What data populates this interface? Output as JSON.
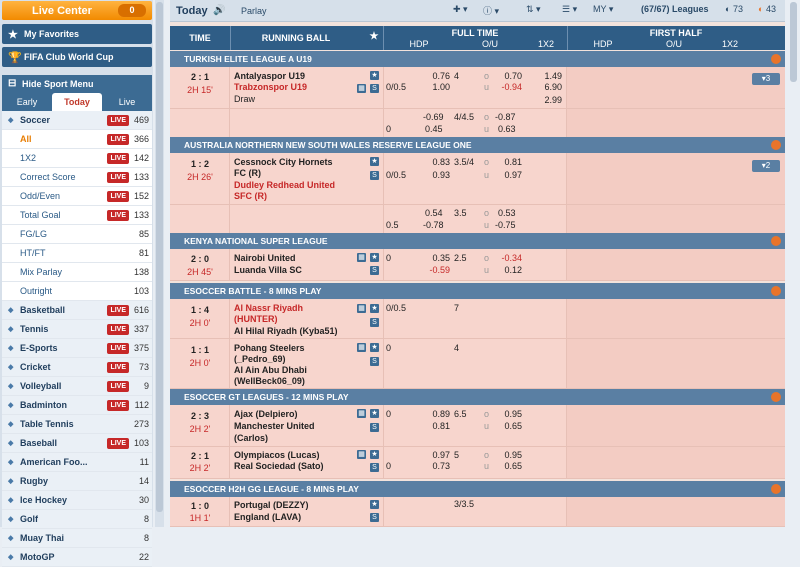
{
  "sidebar": {
    "live_center": "Live Center",
    "live_count": "0",
    "favorites": "My Favorites",
    "club_cup": "FIFA Club World Cup",
    "hide_menu": "Hide Sport Menu",
    "tabs": [
      "Early",
      "Today",
      "Live"
    ],
    "soccer": {
      "label": "Soccer",
      "live": "LIVE",
      "count": "469"
    },
    "soccer_sub": [
      {
        "label": "All",
        "live": "LIVE",
        "count": "366"
      },
      {
        "label": "1X2",
        "live": "LIVE",
        "count": "142"
      },
      {
        "label": "Correct Score",
        "live": "LIVE",
        "count": "133"
      },
      {
        "label": "Odd/Even",
        "live": "LIVE",
        "count": "152"
      },
      {
        "label": "Total Goal",
        "live": "LIVE",
        "count": "133"
      },
      {
        "label": "FG/LG",
        "live": "",
        "count": "85"
      },
      {
        "label": "HT/FT",
        "live": "",
        "count": "81"
      },
      {
        "label": "Mix Parlay",
        "live": "",
        "count": "138"
      },
      {
        "label": "Outright",
        "live": "",
        "count": "103"
      }
    ],
    "sports": [
      {
        "label": "Basketball",
        "live": "LIVE",
        "count": "616"
      },
      {
        "label": "Tennis",
        "live": "LIVE",
        "count": "337"
      },
      {
        "label": "E-Sports",
        "live": "LIVE",
        "count": "375"
      },
      {
        "label": "Cricket",
        "live": "LIVE",
        "count": "73"
      },
      {
        "label": "Volleyball",
        "live": "LIVE",
        "count": "9"
      },
      {
        "label": "Badminton",
        "live": "LIVE",
        "count": "112"
      },
      {
        "label": "Table Tennis",
        "live": "",
        "count": "273"
      },
      {
        "label": "Baseball",
        "live": "LIVE",
        "count": "103"
      },
      {
        "label": "American Foo...",
        "live": "",
        "count": "11"
      },
      {
        "label": "Rugby",
        "live": "",
        "count": "14"
      },
      {
        "label": "Ice Hockey",
        "live": "",
        "count": "30"
      },
      {
        "label": "Golf",
        "live": "",
        "count": "8"
      },
      {
        "label": "Muay Thai",
        "live": "",
        "count": "8"
      },
      {
        "label": "MotoGP",
        "live": "",
        "count": "22"
      }
    ]
  },
  "topbar": {
    "today": "Today",
    "parlay": "Parlay",
    "odds": "MY",
    "leagues": "(67/67) Leagues",
    "c1": "73",
    "c2": "43"
  },
  "header": {
    "time": "TIME",
    "running": "RUNNING BALL",
    "full_time": "FULL TIME",
    "first_half": "FIRST HALF",
    "hdp": "HDP",
    "ou": "O/U",
    "x12": "1X2"
  },
  "leagues": [
    {
      "name": "TURKISH ELITE LEAGUE A U19"
    },
    {
      "name": "AUSTRALIA NORTHERN NEW SOUTH WALES RESERVE LEAGUE ONE"
    },
    {
      "name": "KENYA NATIONAL SUPER LEAGUE"
    },
    {
      "name": "ESOCCER BATTLE - 8 MINS PLAY"
    },
    {
      "name": "ESOCCER GT LEAGUES - 12 MINS PLAY"
    },
    {
      "name": "ESOCCER H2H GG LEAGUE - 8 MINS PLAY"
    }
  ],
  "matches": {
    "m1": {
      "score": "2 : 1",
      "time": "2H 15'",
      "home": "Antalyaspor U19",
      "away": "Trabzonspor U19",
      "draw": "Draw",
      "hdp": "0/0.5",
      "h1": "0.76",
      "h2": "1.00",
      "ou": "4",
      "o1": "0.70",
      "o2": "-0.94",
      "x1": "1.49",
      "x2": "6.90",
      "x3": "2.99",
      "more": "▾3"
    },
    "m1b": {
      "h1": "-0.69",
      "ou": "4/4.5",
      "hdp2": "0",
      "h2": "0.45",
      "o1": "-0.87",
      "o2": "0.63"
    },
    "m2": {
      "score": "1 : 2",
      "time": "2H 26'",
      "home1": "Cessnock City Hornets",
      "home2": "FC (R)",
      "away1": "Dudley Redhead United",
      "away2": "SFC (R)",
      "hdp": "0/0.5",
      "h1": "0.83",
      "h2": "0.93",
      "ou": "3.5/4",
      "o1": "0.81",
      "o2": "0.97",
      "more": "▾2"
    },
    "m2b": {
      "hdp": "0.5",
      "h1": "0.54",
      "h2": "-0.78",
      "ou": "3.5",
      "o1": "0.53",
      "o2": "-0.75"
    },
    "m3": {
      "score": "2 : 0",
      "time": "2H 45'",
      "home": "Nairobi United",
      "away": "Luanda Villa SC",
      "hdp": "0",
      "h1": "0.35",
      "h2": "-0.59",
      "ou": "2.5",
      "o1": "-0.34",
      "o2": "0.12"
    },
    "m4": {
      "score": "1 : 4",
      "time": "2H 0'",
      "home1": "Al Nassr Riyadh",
      "home2": "(HUNTER)",
      "away": "Al Hilal Riyadh (Kyba51)",
      "hdp": "0/0.5",
      "ou": "7"
    },
    "m5": {
      "score": "1 : 1",
      "time": "2H 0'",
      "home1": "Pohang Steelers",
      "home2": "(_Pedro_69)",
      "away1": "Al Ain Abu Dhabi",
      "away2": "(WellBeck06_09)",
      "hdp": "0",
      "ou": "4"
    },
    "m6": {
      "score": "2 : 3",
      "time": "2H 2'",
      "home": "Ajax (Delpiero)",
      "away1": "Manchester United",
      "away2": "(Carlos)",
      "hdp": "0",
      "h1": "0.89",
      "h2": "0.81",
      "ou": "6.5",
      "o1": "0.95",
      "o2": "0.65"
    },
    "m7": {
      "score": "2 : 1",
      "time": "2H 2'",
      "home": "Olympiacos (Lucas)",
      "away": "Real Sociedad (Sato)",
      "hdp": "0",
      "h1": "0.97",
      "h2": "0.73",
      "ou": "5",
      "o1": "0.95",
      "o2": "0.65"
    },
    "m8": {
      "score": "1 : 0",
      "time": "1H 1'",
      "home": "Portugal (DEZZY)",
      "away": "England (LAVA)",
      "ou": "3/3.5"
    }
  }
}
